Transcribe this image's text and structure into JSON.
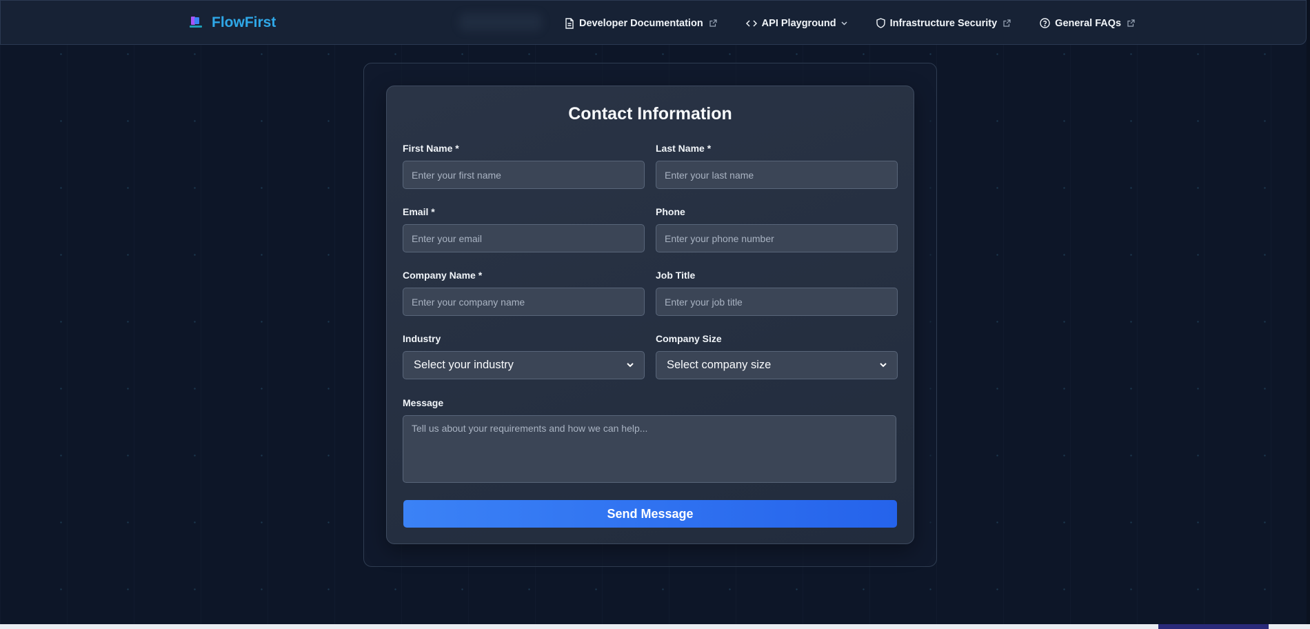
{
  "brand": {
    "name": "FlowFirst",
    "logo_icon": "flowfirst-logo-icon"
  },
  "nav": {
    "items": [
      {
        "label": "Developer Documentation",
        "icon": "document-icon",
        "suffix": "external-link-icon"
      },
      {
        "label": "API Playground",
        "icon": "code-icon",
        "suffix": "chevron-down-icon"
      },
      {
        "label": "Infrastructure Security",
        "icon": "shield-icon",
        "suffix": "external-link-icon"
      },
      {
        "label": "General FAQs",
        "icon": "help-circle-icon",
        "suffix": "external-link-icon"
      }
    ]
  },
  "form": {
    "title": "Contact Information",
    "first_name": {
      "label": "First Name *",
      "placeholder": "Enter your first name",
      "value": ""
    },
    "last_name": {
      "label": "Last Name *",
      "placeholder": "Enter your last name",
      "value": ""
    },
    "email": {
      "label": "Email *",
      "placeholder": "Enter your email",
      "value": ""
    },
    "phone": {
      "label": "Phone",
      "placeholder": "Enter your phone number",
      "value": ""
    },
    "company_name": {
      "label": "Company Name *",
      "placeholder": "Enter your company name",
      "value": ""
    },
    "job_title": {
      "label": "Job Title",
      "placeholder": "Enter your job title",
      "value": ""
    },
    "industry": {
      "label": "Industry",
      "selected": "Select your industry"
    },
    "company_size": {
      "label": "Company Size",
      "selected": "Select company size"
    },
    "message": {
      "label": "Message",
      "placeholder": "Tell us about your requirements and how we can help...",
      "value": ""
    },
    "submit_label": "Send Message"
  },
  "colors": {
    "background": "#0d1628",
    "navbar": "#172235",
    "brand": "#2fa8e8",
    "card": "#2a3446",
    "input": "#3b4556",
    "button": "#3b82f6"
  }
}
